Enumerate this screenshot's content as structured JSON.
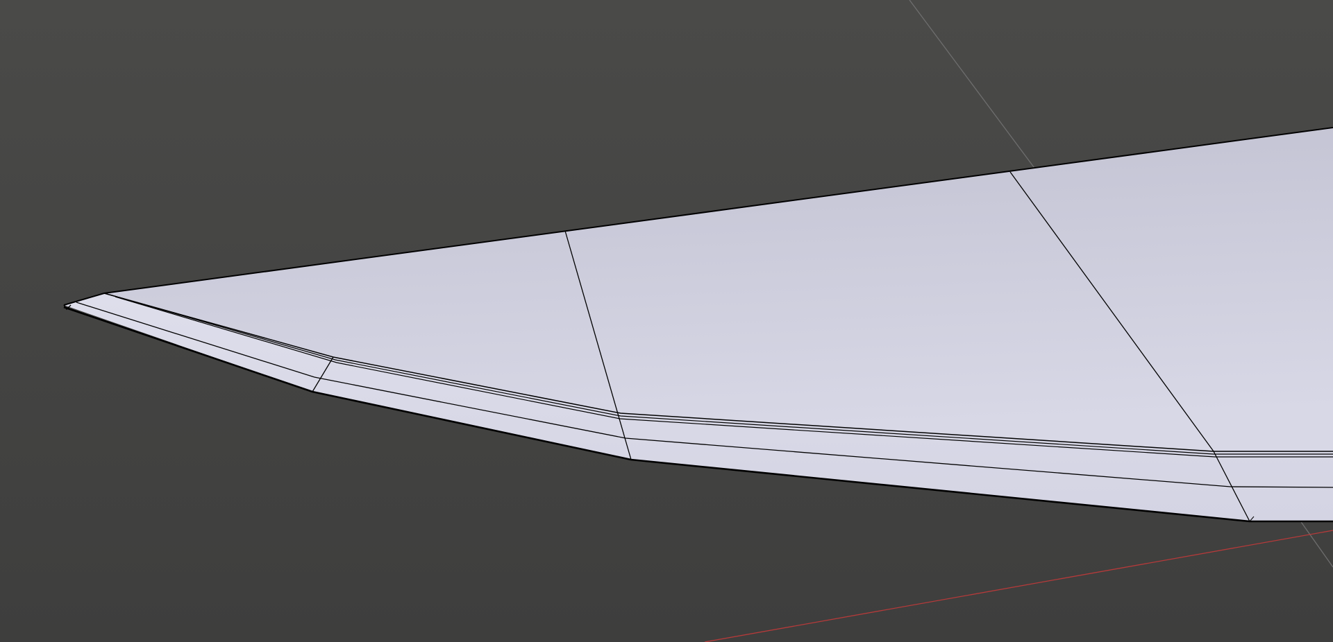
{
  "viewport": {
    "kind": "3d-viewport",
    "background_color": "#404040",
    "mesh_fill_color": "#D2D2E2",
    "wire_color": "#000000",
    "grid_line_color": "#6E6E6E",
    "x_axis_color": "#B63A3A"
  }
}
